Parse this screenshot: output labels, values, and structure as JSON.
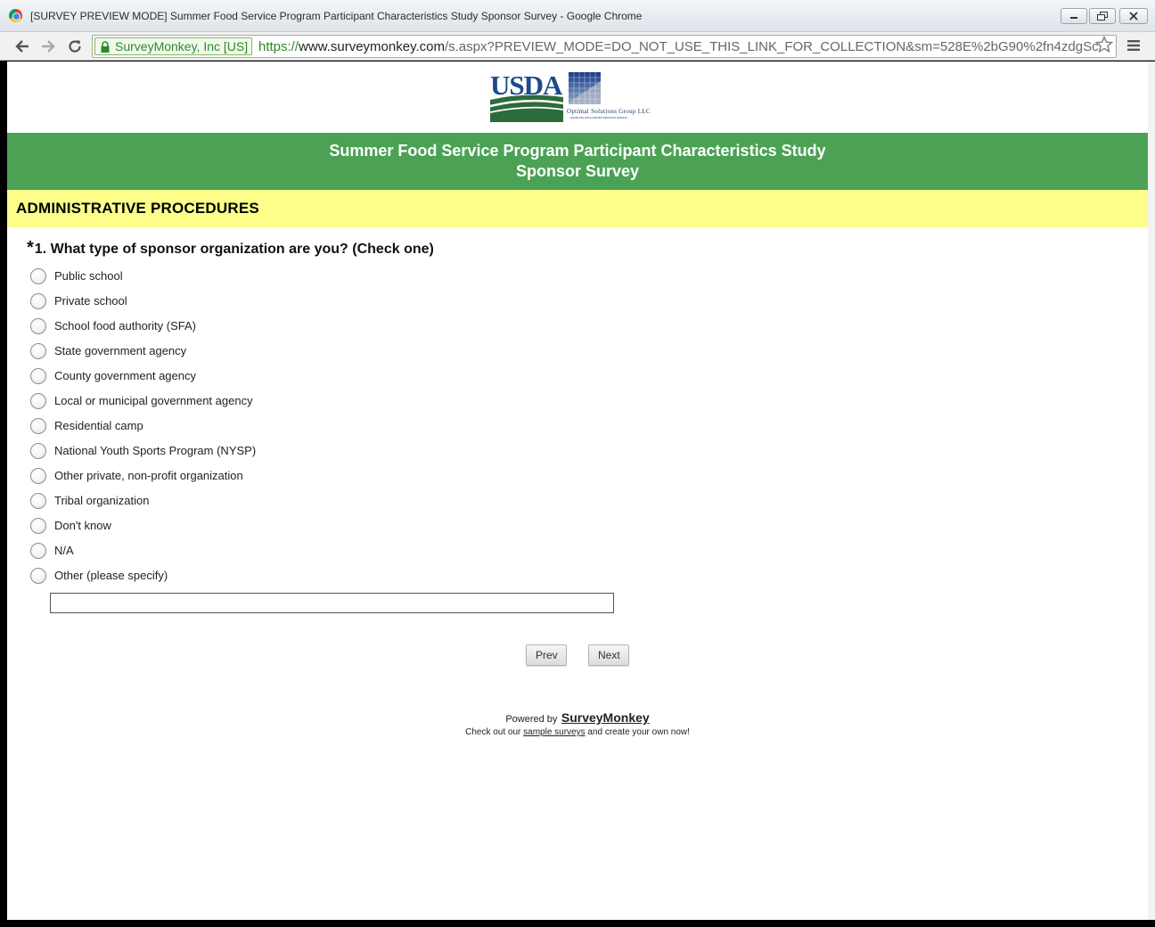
{
  "window": {
    "title": "[SURVEY PREVIEW MODE] Summer Food Service Program Participant Characteristics Study Sponsor Survey - Google Chrome"
  },
  "browser": {
    "ev_cert": "SurveyMonkey, Inc [US]",
    "url_scheme": "https://",
    "url_host": "www.surveymonkey.com",
    "url_path": "/s.aspx?PREVIEW_MODE=DO_NOT_USE_THIS_LINK_FOR_COLLECTION&sm=528E%2bG90%2fn4zdgSc"
  },
  "logos": {
    "usda": "USDA",
    "optimal": "Optimal Solutions Group LLC",
    "optimal_tagline": "ENABLING DATA-DRIVEN DECISION MAKING"
  },
  "banner": {
    "line1": "Summer Food Service Program Participant Characteristics Study",
    "line2": "Sponsor Survey"
  },
  "section": {
    "title": "ADMINISTRATIVE PROCEDURES"
  },
  "question": {
    "required_mark": "*",
    "text": "1. What type of sponsor organization are you? (Check one)",
    "options": [
      "Public school",
      "Private school",
      "School food authority (SFA)",
      "State government agency",
      "County government agency",
      "Local or municipal government agency",
      "Residential camp",
      "National Youth Sports Program (NYSP)",
      "Other private, non-profit organization",
      "Tribal organization",
      "Don't know",
      "N/A",
      "Other (please specify)"
    ],
    "other_value": ""
  },
  "buttons": {
    "prev": "Prev",
    "next": "Next"
  },
  "footer": {
    "powered_by": "Powered by",
    "brand": "SurveyMonkey",
    "line2_prefix": "Check out our",
    "line2_link": "sample surveys",
    "line2_suffix": "and create your own now!"
  },
  "colors": {
    "banner_green": "#4ba254",
    "section_yellow": "#fdfd8a",
    "ev_green": "#2c8a2c",
    "usda_blue": "#1b4a8a",
    "usda_green": "#2d6b3a"
  },
  "icons": [
    "chrome-logo-icon",
    "minimize-icon",
    "restore-icon",
    "close-icon",
    "back-arrow-icon",
    "forward-arrow-icon",
    "reload-icon",
    "lock-icon",
    "star-icon",
    "menu-icon"
  ]
}
